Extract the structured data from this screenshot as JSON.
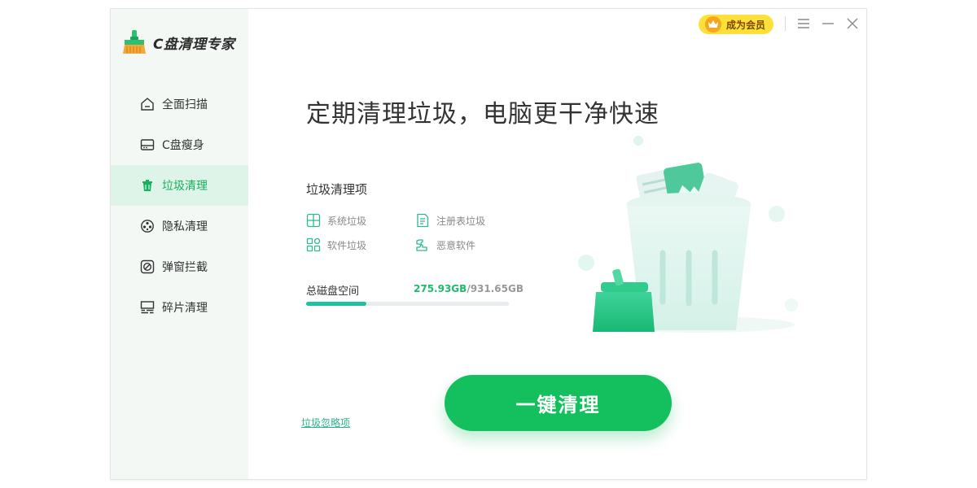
{
  "app": {
    "title": "C盘清理专家"
  },
  "topbar": {
    "vip_label": "成为会员"
  },
  "sidebar": {
    "items": [
      {
        "label": "全面扫描",
        "icon": "home-icon",
        "active": false
      },
      {
        "label": "C盘瘦身",
        "icon": "disk-icon",
        "active": false
      },
      {
        "label": "垃圾清理",
        "icon": "trash-icon",
        "active": true
      },
      {
        "label": "隐私清理",
        "icon": "privacy-icon",
        "active": false
      },
      {
        "label": "弹窗拦截",
        "icon": "block-icon",
        "active": false
      },
      {
        "label": "碎片清理",
        "icon": "fragment-icon",
        "active": false
      }
    ]
  },
  "main": {
    "headline": "定期清理垃圾，电脑更干净快速",
    "section_title": "垃圾清理项",
    "items": [
      {
        "label": "系统垃圾",
        "icon": "windows-icon"
      },
      {
        "label": "注册表垃圾",
        "icon": "registry-icon"
      },
      {
        "label": "软件垃圾",
        "icon": "apps-icon"
      },
      {
        "label": "恶意软件",
        "icon": "malware-icon"
      }
    ],
    "disk": {
      "label": "总磁盘空间",
      "used": "275.93GB",
      "total": "/931.65GB",
      "used_fraction": 0.296
    },
    "ignore_link": "垃圾忽略项",
    "cta_label": "一键清理"
  },
  "colors": {
    "accent": "#14c05d",
    "active_bg": "#dff4e8",
    "vip": "#fde13a"
  }
}
